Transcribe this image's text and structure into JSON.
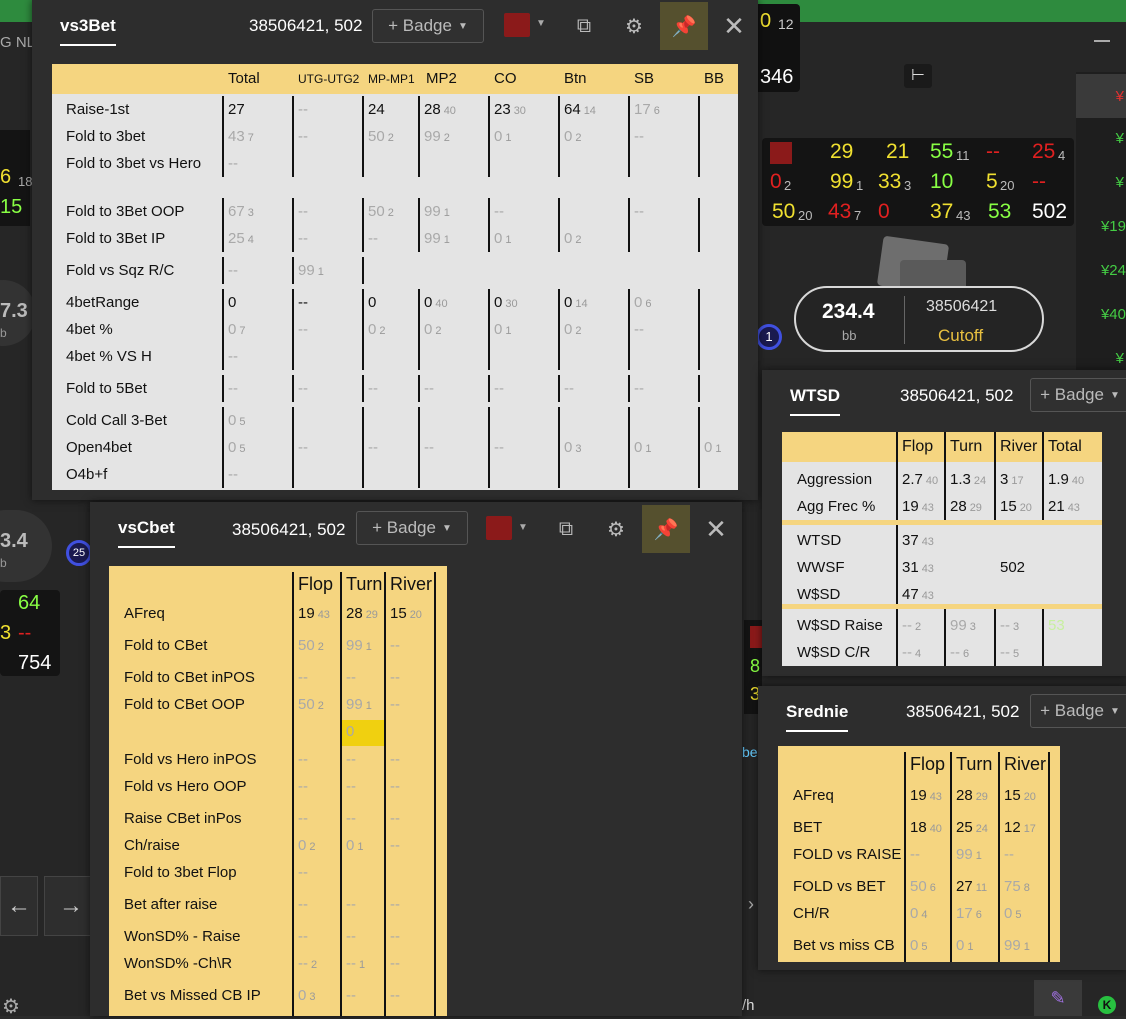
{
  "badge_label": "+ Badge",
  "bg": {
    "top_left_text": "G NL",
    "left_nums": [
      "6",
      "18",
      "15",
      "7.3",
      "b",
      "3.4",
      "b",
      "25"
    ],
    "left_hud": [
      "64",
      "3",
      "--",
      "754"
    ],
    "top_right_nums": [
      "0",
      "12",
      "346"
    ],
    "right_col": [
      "¥",
      "¥",
      "¥",
      "¥19",
      "¥24",
      "¥40",
      "¥"
    ],
    "mini_8": "8",
    "mini_3": "3",
    "mini_be": "be",
    "mini_h": "/h",
    "seat_num": "1",
    "player_stack": "234.4",
    "player_bb": "bb",
    "player_id": "38506421",
    "player_pos": "Cutoff",
    "hud_rows": [
      [
        {
          "v": "29",
          "c": "yellow"
        },
        {
          "v": "21",
          "c": "yellow"
        },
        {
          "v": "55",
          "c": "green",
          "s": "11"
        },
        {
          "v": "--",
          "c": "red"
        },
        {
          "v": "25",
          "c": "red",
          "s": "4"
        }
      ],
      [
        {
          "v": "0",
          "c": "red",
          "s": "2"
        },
        {
          "v": "99",
          "c": "yellow",
          "s": "1"
        },
        {
          "v": "33",
          "c": "yellow",
          "s": "3"
        },
        {
          "v": "10",
          "c": "green"
        },
        {
          "v": "5",
          "c": "yellow",
          "s": "20"
        },
        {
          "v": "--",
          "c": "red"
        }
      ],
      [
        {
          "v": "50",
          "c": "yellow",
          "s": "20"
        },
        {
          "v": "43",
          "c": "red",
          "s": "7"
        },
        {
          "v": "0",
          "c": "red"
        },
        {
          "v": "37",
          "c": "yellow",
          "s": "43"
        },
        {
          "v": "53",
          "c": "green"
        },
        {
          "v": "502",
          "c": "white"
        }
      ]
    ]
  },
  "vs3bet": {
    "title": "vs3Bet",
    "player": "38506421, 502",
    "headers": [
      "",
      "Total",
      "UTG-UTG2",
      "MP-MP1",
      "MP2",
      "CO",
      "Btn",
      "SB",
      "BB"
    ],
    "rows": [
      {
        "label": "Raise-1st",
        "cells": [
          [
            "27",
            ""
          ],
          [
            "--",
            ""
          ],
          [
            "24",
            ""
          ],
          [
            "28",
            "40"
          ],
          [
            "23",
            "30"
          ],
          [
            "64",
            "14"
          ],
          [
            "17",
            "6"
          ],
          [
            "",
            ""
          ]
        ]
      },
      {
        "label": "Fold to 3bet",
        "cells": [
          [
            "43",
            "7"
          ],
          [
            "--",
            ""
          ],
          [
            "50",
            "2"
          ],
          [
            "99",
            "2"
          ],
          [
            "0",
            "1"
          ],
          [
            "0",
            "2"
          ],
          [
            "--",
            ""
          ],
          [
            "",
            ""
          ]
        ]
      },
      {
        "label": "Fold to 3bet vs Hero",
        "cells": [
          [
            "--",
            ""
          ]
        ]
      },
      {
        "label": "",
        "cells": []
      },
      {
        "label": "Fold to 3Bet OOP",
        "cells": [
          [
            "67",
            "3"
          ],
          [
            "--",
            ""
          ],
          [
            "50",
            "2"
          ],
          [
            "99",
            "1"
          ],
          [
            "--",
            ""
          ],
          [
            "",
            ""
          ],
          [
            "--",
            ""
          ],
          [
            "",
            ""
          ]
        ]
      },
      {
        "label": "Fold to 3Bet IP",
        "cells": [
          [
            "25",
            "4"
          ],
          [
            "--",
            ""
          ],
          [
            "--",
            ""
          ],
          [
            "99",
            "1"
          ],
          [
            "0",
            "1"
          ],
          [
            "0",
            "2"
          ],
          [
            "",
            ""
          ],
          [
            "",
            ""
          ]
        ]
      },
      {
        "label": "Fold vs Sqz R/C",
        "cells": [
          [
            "--",
            ""
          ],
          [
            "99",
            "1"
          ]
        ]
      },
      {
        "label": "4betRange",
        "cells": [
          [
            "0",
            ""
          ],
          [
            "--",
            ""
          ],
          [
            "0",
            ""
          ],
          [
            "0",
            "40"
          ],
          [
            "0",
            "30"
          ],
          [
            "0",
            "14"
          ],
          [
            "0",
            "6"
          ],
          [
            "",
            ""
          ]
        ]
      },
      {
        "label": "4bet %",
        "cells": [
          [
            "0",
            "7"
          ],
          [
            "--",
            ""
          ],
          [
            "0",
            "2"
          ],
          [
            "0",
            "2"
          ],
          [
            "0",
            "1"
          ],
          [
            "0",
            "2"
          ],
          [
            "--",
            ""
          ],
          [
            "",
            ""
          ]
        ]
      },
      {
        "label": "4bet % VS H",
        "cells": [
          [
            "--",
            ""
          ]
        ]
      },
      {
        "label": "Fold to 5Bet",
        "cells": [
          [
            "--",
            ""
          ],
          [
            "--",
            ""
          ],
          [
            "--",
            ""
          ],
          [
            "--",
            ""
          ],
          [
            "--",
            ""
          ],
          [
            "--",
            ""
          ],
          [
            "--",
            ""
          ],
          [
            "",
            ""
          ]
        ]
      },
      {
        "label": "Cold Call 3-Bet",
        "cells": [
          [
            "0",
            "5"
          ]
        ]
      },
      {
        "label": "Open4bet",
        "cells": [
          [
            "0",
            "5"
          ],
          [
            "--",
            ""
          ],
          [
            "--",
            ""
          ],
          [
            "--",
            ""
          ],
          [
            "--",
            ""
          ],
          [
            "0",
            "3"
          ],
          [
            "0",
            "1"
          ],
          [
            "0",
            "1"
          ]
        ]
      },
      {
        "label": "O4b+f",
        "cells": [
          [
            "--",
            ""
          ]
        ]
      }
    ]
  },
  "vscbet": {
    "title": "vsCbet",
    "player": "38506421, 502",
    "headers": [
      "",
      "Flop",
      "Turn",
      "River"
    ],
    "rows": [
      {
        "label": "AFreq",
        "cells": [
          [
            "19",
            "43"
          ],
          [
            "28",
            "29"
          ],
          [
            "15",
            "20"
          ]
        ]
      },
      {
        "label": "Fold to CBet",
        "cells": [
          [
            "50",
            "2"
          ],
          [
            "99",
            "1"
          ],
          [
            "--",
            ""
          ]
        ]
      },
      {
        "label": "Fold to CBet inPOS",
        "cells": [
          [
            "--",
            ""
          ],
          [
            "--",
            ""
          ],
          [
            "--",
            ""
          ]
        ]
      },
      {
        "label": "Fold to CBet OOP",
        "cells": [
          [
            "50",
            "2"
          ],
          [
            "99",
            "1"
          ],
          [
            "--",
            ""
          ]
        ]
      },
      {
        "label": "",
        "cells": [
          [
            "",
            ""
          ],
          [
            "0",
            ""
          ],
          [
            "",
            ""
          ]
        ]
      },
      {
        "label": "Fold vs Hero inPOS",
        "cells": [
          [
            "--",
            ""
          ],
          [
            "--",
            ""
          ],
          [
            "--",
            ""
          ]
        ]
      },
      {
        "label": "Fold vs Hero OOP",
        "cells": [
          [
            "--",
            ""
          ],
          [
            "--",
            ""
          ],
          [
            "--",
            ""
          ]
        ]
      },
      {
        "label": "Raise CBet inPos",
        "cells": [
          [
            "--",
            ""
          ],
          [
            "--",
            ""
          ],
          [
            "--",
            ""
          ]
        ]
      },
      {
        "label": "Ch/raise",
        "cells": [
          [
            "0",
            "2"
          ],
          [
            "0",
            "1"
          ],
          [
            "--",
            ""
          ]
        ]
      },
      {
        "label": "Fold to 3bet Flop",
        "cells": [
          [
            "--",
            ""
          ],
          [
            "",
            ""
          ],
          [
            "",
            ""
          ]
        ]
      },
      {
        "label": "Bet after raise",
        "cells": [
          [
            "--",
            ""
          ],
          [
            "--",
            ""
          ],
          [
            "--",
            ""
          ]
        ]
      },
      {
        "label": "WonSD% - Raise",
        "cells": [
          [
            "--",
            ""
          ],
          [
            "--",
            ""
          ],
          [
            "--",
            ""
          ]
        ]
      },
      {
        "label": "WonSD% -Ch\\R",
        "cells": [
          [
            "--",
            "2"
          ],
          [
            "--",
            "1"
          ],
          [
            "--",
            ""
          ]
        ]
      },
      {
        "label": "Bet vs Missed CB IP",
        "cells": [
          [
            "0",
            "3"
          ],
          [
            "--",
            ""
          ],
          [
            "--",
            ""
          ]
        ]
      }
    ]
  },
  "wtsd": {
    "title": "WTSD",
    "player": "38506421, 502",
    "headers": [
      "",
      "Flop",
      "Turn",
      "River",
      "Total"
    ],
    "agg_rows": [
      {
        "label": "Aggression",
        "cells": [
          [
            "2.7",
            "40"
          ],
          [
            "1.3",
            "24"
          ],
          [
            "3",
            "17"
          ],
          [
            "1.9",
            "40"
          ]
        ]
      },
      {
        "label": "Agg Frec %",
        "cells": [
          [
            "19",
            "43"
          ],
          [
            "28",
            "29"
          ],
          [
            "15",
            "20"
          ],
          [
            "21",
            "43"
          ]
        ]
      }
    ],
    "wt_rows": [
      {
        "label": "WTSD",
        "v": "37",
        "s": "43"
      },
      {
        "label": "WWSF",
        "v": "31",
        "s": "43"
      },
      {
        "label": "W$SD",
        "v": "47",
        "s": "43"
      }
    ],
    "hands": "502",
    "raise_rows": [
      {
        "label": "W$SD Raise",
        "cells": [
          [
            "--",
            "2"
          ],
          [
            "99",
            "3"
          ],
          [
            "--",
            "3"
          ],
          [
            "53",
            ""
          ]
        ]
      },
      {
        "label": "W$SD C/R",
        "cells": [
          [
            "--",
            "4"
          ],
          [
            "--",
            "6"
          ],
          [
            "--",
            "5"
          ],
          [
            "",
            ""
          ]
        ]
      }
    ]
  },
  "srednie": {
    "title": "Srednie",
    "player": "38506421, 502",
    "headers": [
      "",
      "Flop",
      "Turn",
      "River"
    ],
    "rows": [
      {
        "label": "AFreq",
        "cells": [
          [
            "19",
            "43"
          ],
          [
            "28",
            "29"
          ],
          [
            "15",
            "20"
          ]
        ]
      },
      {
        "label": "BET",
        "cells": [
          [
            "18",
            "40"
          ],
          [
            "25",
            "24"
          ],
          [
            "12",
            "17"
          ]
        ]
      },
      {
        "label": "FOLD vs RAISE",
        "cells": [
          [
            "--",
            ""
          ],
          [
            "99",
            "1"
          ],
          [
            "--",
            ""
          ]
        ]
      },
      {
        "label": "FOLD vs BET",
        "cells": [
          [
            "50",
            "6"
          ],
          [
            "27",
            "11"
          ],
          [
            "75",
            "8"
          ]
        ]
      },
      {
        "label": "CH/R",
        "cells": [
          [
            "0",
            "4"
          ],
          [
            "17",
            "6"
          ],
          [
            "0",
            "5"
          ]
        ]
      },
      {
        "label": "Bet vs miss CB",
        "cells": [
          [
            "0",
            "5"
          ],
          [
            "0",
            "1"
          ],
          [
            "99",
            "1"
          ]
        ]
      }
    ]
  }
}
